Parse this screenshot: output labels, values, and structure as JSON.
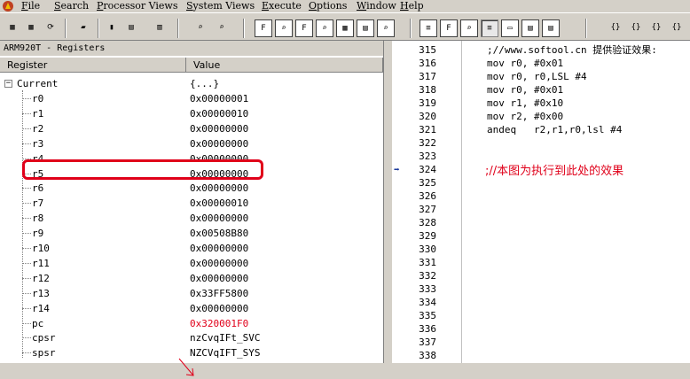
{
  "menu": [
    {
      "label": "File",
      "u": "F",
      "rest": "ile"
    },
    {
      "label": "Search",
      "u": "S",
      "rest": "earch"
    },
    {
      "label": "Processor Views",
      "u": "P",
      "rest": "rocessor Views"
    },
    {
      "label": "System Views",
      "u": "S",
      "rest": "ystem Views"
    },
    {
      "label": "Execute",
      "u": "E",
      "rest": "xecute"
    },
    {
      "label": "Options",
      "u": "O",
      "rest": "ptions"
    },
    {
      "label": "Window",
      "u": "W",
      "rest": "indow"
    },
    {
      "label": "Help",
      "u": "H",
      "rest": "elp"
    }
  ],
  "colors": {
    "accent_red": "#e0001a",
    "arrow_blue": "#1e3c9e",
    "window_bg": "#d4d0c8"
  },
  "registers": {
    "title": "ARM920T - Registers",
    "col_register": "Register",
    "col_value": "Value",
    "root_label": "Current",
    "root_value": "{...}",
    "rows": [
      {
        "name": "r0",
        "value": "0x00000001"
      },
      {
        "name": "r1",
        "value": "0x00000010"
      },
      {
        "name": "r2",
        "value": "0x00000000"
      },
      {
        "name": "r3",
        "value": "0x00000000"
      },
      {
        "name": "r4",
        "value": "0x00000000"
      },
      {
        "name": "r5",
        "value": "0x00000000"
      },
      {
        "name": "r6",
        "value": "0x00000000"
      },
      {
        "name": "r7",
        "value": "0x00000010"
      },
      {
        "name": "r8",
        "value": "0x00000000"
      },
      {
        "name": "r9",
        "value": "0x00508B80"
      },
      {
        "name": "r10",
        "value": "0x00000000"
      },
      {
        "name": "r11",
        "value": "0x00000000"
      },
      {
        "name": "r12",
        "value": "0x00000000"
      },
      {
        "name": "r13",
        "value": "0x33FF5800"
      },
      {
        "name": "r14",
        "value": "0x00000000"
      },
      {
        "name": "pc",
        "value": "0x320001F0",
        "changed": true
      },
      {
        "name": "cpsr",
        "value": "nzCvqIFt_SVC"
      },
      {
        "name": "spsr",
        "value": "NZCVqIFT_SYS"
      }
    ]
  },
  "code": {
    "lines": [
      {
        "n": "315",
        "text": ";//www.softool.cn 提供验证效果:"
      },
      {
        "n": "316",
        "text": "mov r0, #0x01"
      },
      {
        "n": "317",
        "text": "mov r0, r0,LSL #4"
      },
      {
        "n": "318",
        "text": "mov r0, #0x01"
      },
      {
        "n": "319",
        "text": "mov r1, #0x10"
      },
      {
        "n": "320",
        "text": "mov r2, #0x00"
      },
      {
        "n": "321",
        "text": "andeq   r2,r1,r0,lsl #4"
      },
      {
        "n": "322",
        "text": ""
      },
      {
        "n": "323",
        "text": ""
      },
      {
        "n": "324",
        "text": ""
      },
      {
        "n": "325",
        "text": ""
      },
      {
        "n": "326",
        "text": ""
      },
      {
        "n": "327",
        "text": ""
      },
      {
        "n": "328",
        "text": ""
      },
      {
        "n": "329",
        "text": ""
      },
      {
        "n": "330",
        "text": ""
      },
      {
        "n": "331",
        "text": ""
      },
      {
        "n": "332",
        "text": ""
      },
      {
        "n": "333",
        "text": ""
      },
      {
        "n": "334",
        "text": ""
      },
      {
        "n": "335",
        "text": ""
      },
      {
        "n": "336",
        "text": ""
      },
      {
        "n": "337",
        "text": ""
      },
      {
        "n": "338",
        "text": ""
      }
    ],
    "current_line": "324",
    "annotation": ";//本图为执行到此处的效果"
  }
}
